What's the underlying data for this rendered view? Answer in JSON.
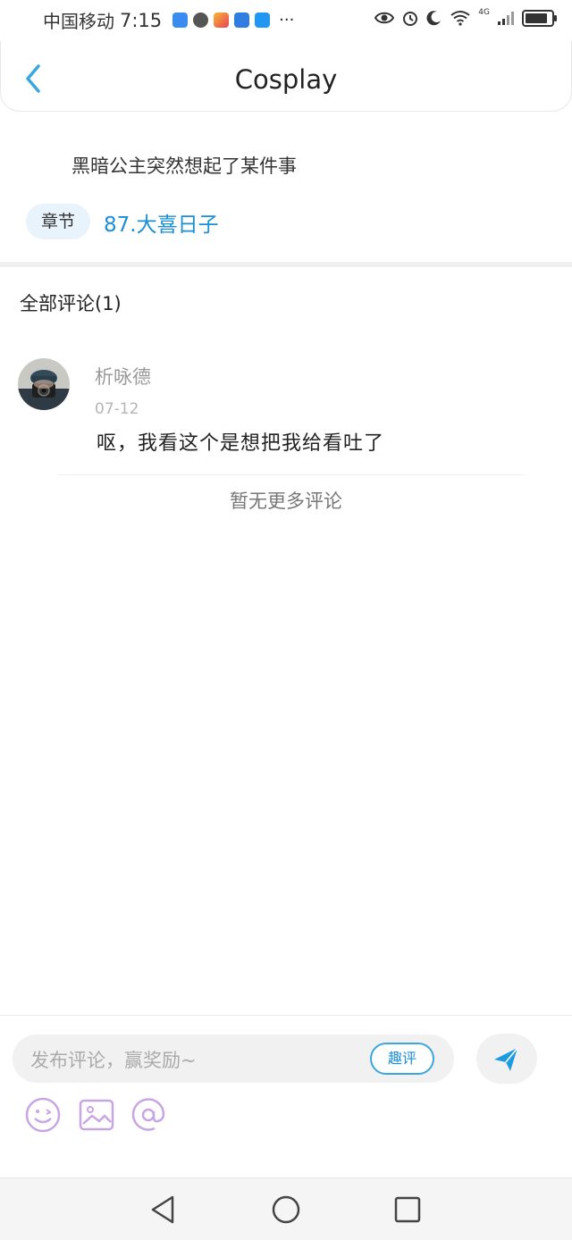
{
  "status_bar": {
    "carrier": "中国移动",
    "time": "7:15",
    "more": "···",
    "network": "4G",
    "battery_level": 0.85
  },
  "header": {
    "title": "Cosplay"
  },
  "post": {
    "summary": "黑暗公主突然想起了某件事",
    "chapter_tag": "章节",
    "chapter_link": "87.大喜日子"
  },
  "comments": {
    "heading": "全部评论(1)",
    "items": [
      {
        "username": "析咏德",
        "date": "07-12",
        "text": "呕，我看这个是想把我给看吐了"
      }
    ],
    "no_more": "暂无更多评论"
  },
  "composer": {
    "placeholder": "发布评论，赢奖励~",
    "quping_label": "趣评",
    "icons": [
      "emoji-icon",
      "image-icon",
      "at-icon",
      "send-icon"
    ]
  },
  "colors": {
    "accent_blue": "#1a8fd6",
    "tool_purple": "#c8a6e6",
    "send_blue": "#1e9be0"
  }
}
